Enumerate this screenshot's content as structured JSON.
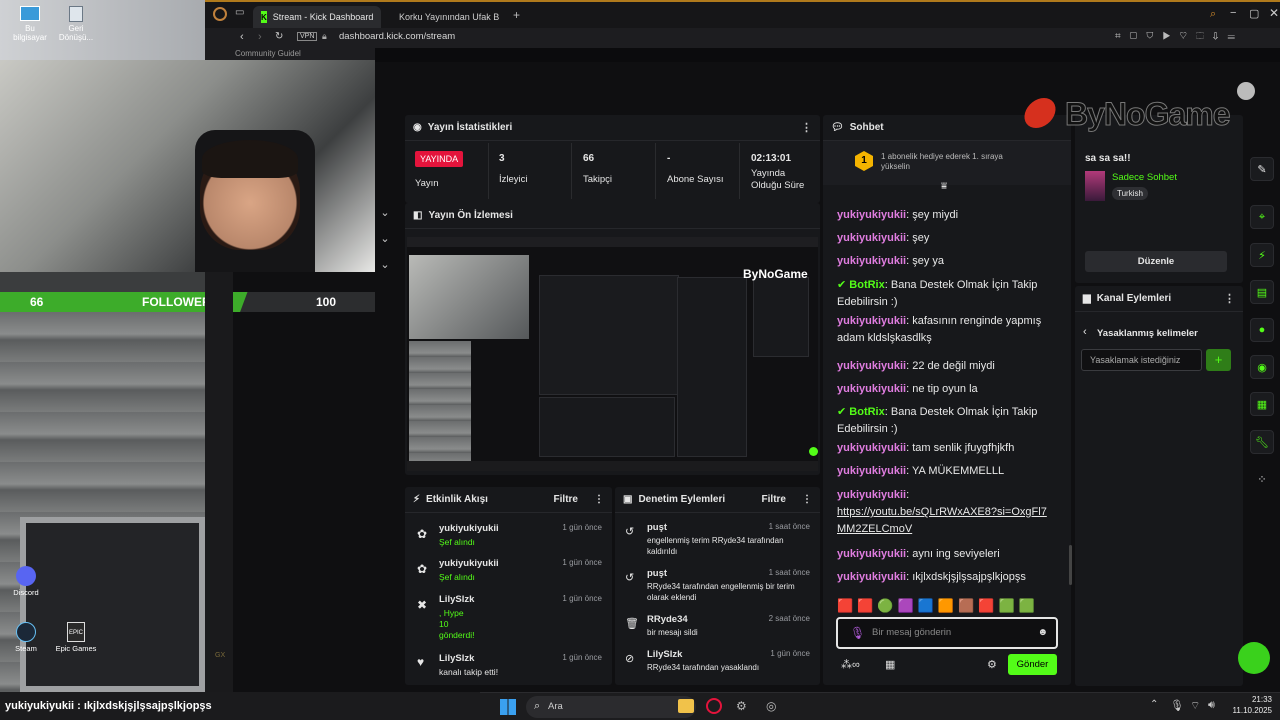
{
  "browser": {
    "tabs": [
      {
        "label": "Stream - Kick Dashboard",
        "active": true
      },
      {
        "label": "Korku Yayınından Ufak B"
      }
    ],
    "url": "dashboard.kick.com/stream",
    "vpn_label": "VPN",
    "bookmark": "Community Guidel"
  },
  "desktop": {
    "icons": [
      "Bu bilgisayar",
      "Geri Dönüşü...",
      "Discord",
      "Steam",
      "Epic Games"
    ]
  },
  "overlay": {
    "followers_current": "66",
    "followers_label": "FOLLOWERS",
    "followers_goal": "100",
    "follower_progress": 0.66,
    "watermark": "ByNoGame"
  },
  "stats": {
    "title": "Yayın İstatistikleri",
    "live_badge": "YAYINDA",
    "live_label": "Yayın",
    "viewers_value": "3",
    "viewers_label": "İzleyici",
    "followers_value": "66",
    "followers_label": "Takipçi",
    "subs_value": "-",
    "subs_label": "Abone Sayısı",
    "uptime_value": "02:13:01",
    "uptime_label": "Yayında Olduğu Süre"
  },
  "preview": {
    "title": "Yayın Ön İzlemesi"
  },
  "activity": {
    "title": "Etkinlik Akışı",
    "filter": "Filtre",
    "items": [
      {
        "user": "yukiyukiyukii",
        "action": "Şef alındı",
        "time": "1 gün önce",
        "icon": "gift"
      },
      {
        "user": "yukiyukiyukii",
        "action": "Şef alındı",
        "time": "1 gün önce",
        "icon": "gift"
      },
      {
        "user": "LilySlzk",
        "action": ", Hype",
        "action2": "10",
        "action3": "gönderdi!",
        "time": "1 gün önce",
        "icon": "kicks"
      },
      {
        "user": "LilySlzk",
        "action": "kanalı takip etti!",
        "time": "1 gün önce",
        "icon": "heart"
      }
    ]
  },
  "moderation": {
    "title": "Denetim Eylemleri",
    "filter": "Filtre",
    "items": [
      {
        "user": "puşt",
        "time": "1 saat önce",
        "line1": "engellenmiş terim RRyde34 tarafından",
        "line2": "kaldırıldı"
      },
      {
        "user": "puşt",
        "time": "1 saat önce",
        "line1": "RRyde34 tarafından engellenmiş bir terim",
        "line2": "olarak eklendi"
      },
      {
        "user": "RRyde34",
        "time": "2 saat önce",
        "line1": "bir mesajı sildi",
        "line2": ""
      },
      {
        "user": "LilySlzk",
        "time": "1 gün önce",
        "line1": "RRyde34 tarafından yasaklandı",
        "line2": ""
      }
    ]
  },
  "chat": {
    "title": "Sohbet",
    "gift_banner": "1 abonelik hediye ederek 1. sıraya yükselin",
    "messages": [
      {
        "user": "yukiyukiyukii",
        "text": "şey miydi"
      },
      {
        "user": "yukiyukiyukii",
        "text": "şey"
      },
      {
        "user": "yukiyukiyukii",
        "text": "şey ya"
      },
      {
        "bot": "BotRix",
        "text": "Bana Destek Olmak İçin Takip Edebilirsin :)"
      },
      {
        "user": "yukiyukiyukii",
        "text": "kafasının renginde yapmış adam kldslşkasdlkş"
      },
      {
        "user": "yukiyukiyukii",
        "text": "22 de değil miydi"
      },
      {
        "user": "yukiyukiyukii",
        "text": "ne tip oyun la"
      },
      {
        "bot": "BotRix",
        "text": "Bana Destek Olmak İçin Takip Edebilirsin :)"
      },
      {
        "user": "yukiyukiyukii",
        "text": "tam senlik jfuygfhjkfh"
      },
      {
        "user": "yukiyukiyukii",
        "text": "YA MÜKEMMELLL"
      },
      {
        "user": "yukiyukiyukii",
        "text": "",
        "link": "https://youtu.be/sQLrRWxAXE8?si=OxgFl7MM2ZELCmoV"
      },
      {
        "user": "yukiyukiyukii",
        "text": "aynı ing seviyeleri"
      },
      {
        "user": "yukiyukiyukii",
        "text": "ıkjlxdskjşjlşsajpşlkjopşs"
      }
    ],
    "input_placeholder": "Bir mesaj gönderin",
    "send_label": "Gönder"
  },
  "right": {
    "top_text": "sa sa sa!!",
    "mode_label": "Sadece Sohbet",
    "lang_badge": "Turkish",
    "edit_button": "Düzenle",
    "channel_actions_title": "Kanal Eylemleri",
    "banned_words_title": "Yasaklanmış kelimeler",
    "banned_input_placeholder": "Yasaklamak istediğiniz"
  },
  "ticker": "yukiyukiyukii : ıkjlxdskjşjlşsajpşlkjopşs",
  "taskbar": {
    "search": "Ara",
    "time": "21:33",
    "date": "11.10.2025"
  },
  "colors": {
    "accent": "#53fc18",
    "live": "#e4143c",
    "username": "#e07de0"
  }
}
